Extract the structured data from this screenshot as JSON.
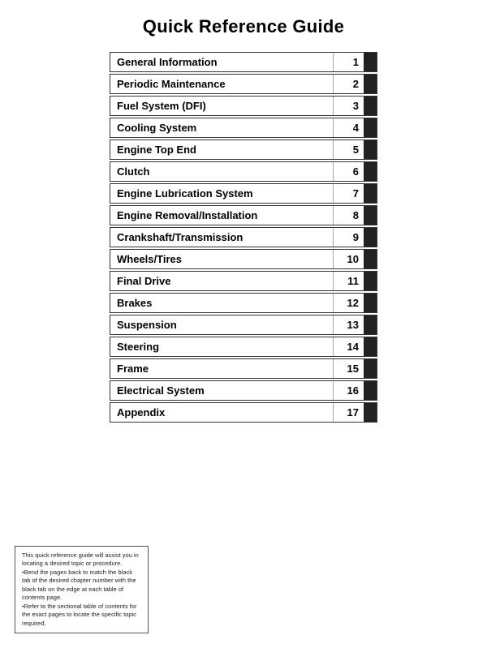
{
  "page": {
    "title": "Quick Reference Guide",
    "rows": [
      {
        "label": "General Information",
        "number": "1"
      },
      {
        "label": "Periodic Maintenance",
        "number": "2"
      },
      {
        "label": "Fuel System (DFI)",
        "number": "3"
      },
      {
        "label": "Cooling System",
        "number": "4"
      },
      {
        "label": "Engine Top End",
        "number": "5"
      },
      {
        "label": "Clutch",
        "number": "6"
      },
      {
        "label": "Engine Lubrication System",
        "number": "7"
      },
      {
        "label": "Engine Removal/Installation",
        "number": "8"
      },
      {
        "label": "Crankshaft/Transmission",
        "number": "9"
      },
      {
        "label": "Wheels/Tires",
        "number": "10"
      },
      {
        "label": "Final Drive",
        "number": "11"
      },
      {
        "label": "Brakes",
        "number": "12"
      },
      {
        "label": "Suspension",
        "number": "13"
      },
      {
        "label": "Steering",
        "number": "14"
      },
      {
        "label": "Frame",
        "number": "15"
      },
      {
        "label": "Electrical System",
        "number": "16"
      },
      {
        "label": "Appendix",
        "number": "17"
      }
    ],
    "note": {
      "line1": "This quick reference guide will assist you in locating a desired topic or procedure.",
      "line2": "•Bend the pages back to match the black tab of the desired chapter number with the black tab on the edge at each table of contents page.",
      "line3": "•Refer to the sectional table of contents for the exact pages to locate the specific topic required."
    }
  }
}
